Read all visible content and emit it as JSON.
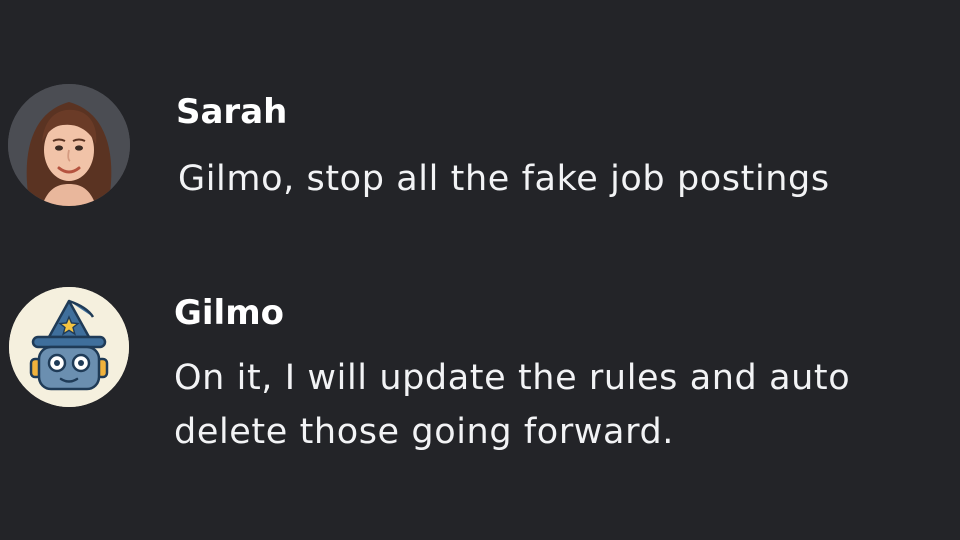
{
  "messages": [
    {
      "author": "Sarah",
      "avatar": "user-photo-avatar",
      "lines": [
        "Gilmo, stop all the fake job postings"
      ]
    },
    {
      "author": "Gilmo",
      "avatar": "wizard-bot-icon",
      "lines": [
        "On it, I will update the rules and auto",
        "delete those going forward."
      ]
    }
  ],
  "colors": {
    "background": "#232428",
    "author_text": "#ffffff",
    "message_text": "#f2f3f5"
  }
}
